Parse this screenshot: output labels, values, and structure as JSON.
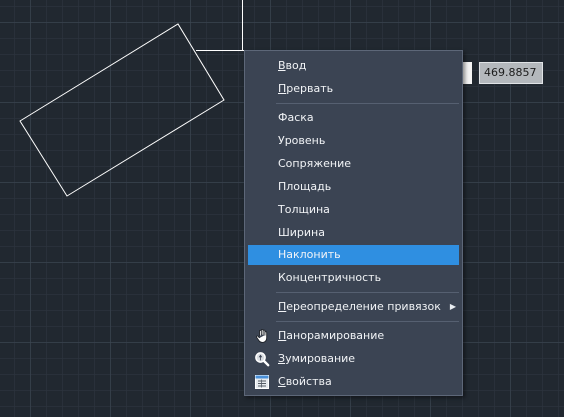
{
  "dimension_input": {
    "value": "469.8857"
  },
  "context_menu": {
    "group_top": [
      {
        "label": "Ввод",
        "underline_first": true
      },
      {
        "label": "Прервать",
        "underline_first": true
      }
    ],
    "group_options": [
      {
        "label": "Фаска"
      },
      {
        "label": "Уровень"
      },
      {
        "label": "Сопряжение"
      },
      {
        "label": "Площадь"
      },
      {
        "label": "Толщина"
      },
      {
        "label": "Ширина"
      },
      {
        "label": "Наклонить",
        "active": true
      },
      {
        "label": "Концентричность"
      }
    ],
    "group_snap": [
      {
        "label": "Переопределение привязок",
        "submenu": true,
        "underline_first": true
      }
    ],
    "group_view": [
      {
        "label": "Панорамирование",
        "icon": "pan-hand-icon",
        "underline_first": true
      },
      {
        "label": "Зумирование",
        "icon": "zoom-magnifier-icon",
        "underline_first": true
      },
      {
        "label": "Свойства",
        "icon": "properties-icon",
        "underline_first": true
      }
    ]
  },
  "colors": {
    "canvas_background": "#212830",
    "menu_background": "#3b4453",
    "menu_highlight": "#2f8fe1",
    "drawing_line": "#ffffff"
  }
}
